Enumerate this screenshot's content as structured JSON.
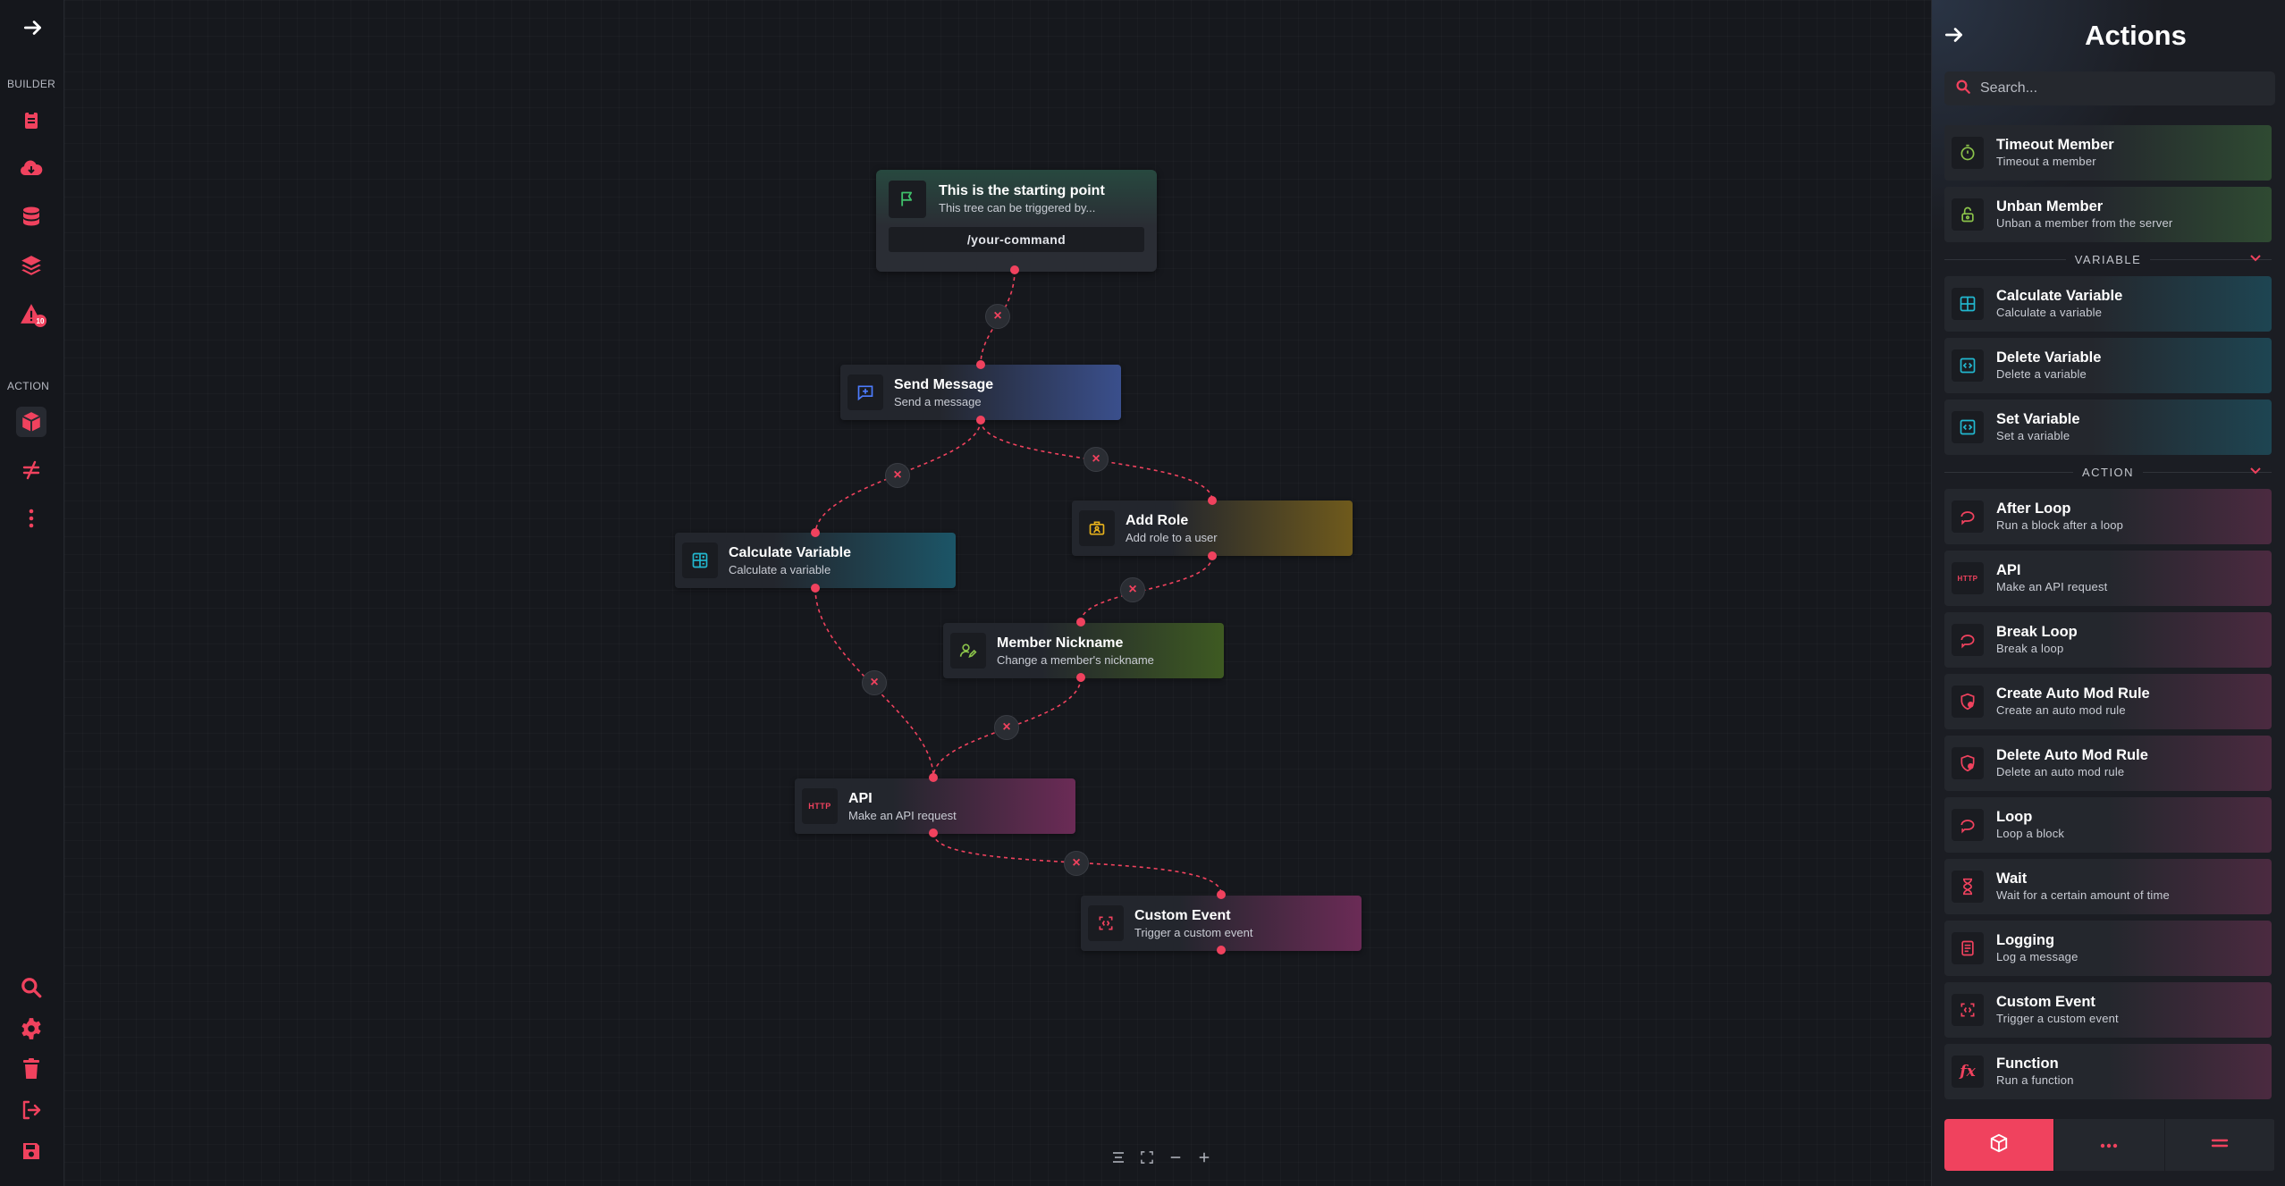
{
  "sidebar": {
    "builder_label": "BUILDER",
    "action_label": "ACTION",
    "alert_count": "10"
  },
  "canvas": {
    "start": {
      "title": "This is the starting point",
      "desc": "This tree can be triggered by...",
      "command": "/your-command"
    },
    "nodes": [
      {
        "title": "Send Message",
        "desc": "Send a message"
      },
      {
        "title": "Add Role",
        "desc": "Add role to a user"
      },
      {
        "title": "Calculate Variable",
        "desc": "Calculate a variable"
      },
      {
        "title": "Member Nickname",
        "desc": "Change a member's nickname"
      },
      {
        "title": "API",
        "desc": "Make an API request"
      },
      {
        "title": "Custom Event",
        "desc": "Trigger a custom event"
      }
    ],
    "http_icon_text": "HTTP"
  },
  "panel": {
    "title": "Actions",
    "search_placeholder": "Search...",
    "top_items": [
      {
        "title": "Timeout Member",
        "desc": "Timeout a member"
      },
      {
        "title": "Unban Member",
        "desc": "Unban a member from the server"
      }
    ],
    "variable_label": "VARIABLE",
    "variable_items": [
      {
        "title": "Calculate Variable",
        "desc": "Calculate a variable"
      },
      {
        "title": "Delete Variable",
        "desc": "Delete a variable"
      },
      {
        "title": "Set Variable",
        "desc": "Set a variable"
      }
    ],
    "action_label": "ACTION",
    "action_items": [
      {
        "title": "After Loop",
        "desc": "Run a block after a loop"
      },
      {
        "title": "API",
        "desc": "Make an API request"
      },
      {
        "title": "Break Loop",
        "desc": "Break a loop"
      },
      {
        "title": "Create Auto Mod Rule",
        "desc": "Create an auto mod rule"
      },
      {
        "title": "Delete Auto Mod Rule",
        "desc": "Delete an auto mod rule"
      },
      {
        "title": "Loop",
        "desc": "Loop a block"
      },
      {
        "title": "Wait",
        "desc": "Wait for a certain amount of time"
      },
      {
        "title": "Logging",
        "desc": "Log a message"
      },
      {
        "title": "Custom Event",
        "desc": "Trigger a custom event"
      },
      {
        "title": "Function",
        "desc": "Run a function"
      }
    ]
  },
  "colors": {
    "accent": "#f0425e",
    "green": "#3fbf6a",
    "teal": "#22b8d0",
    "blue": "#4d7cff",
    "gold": "#e8b21c",
    "lime": "#8bc34a"
  }
}
